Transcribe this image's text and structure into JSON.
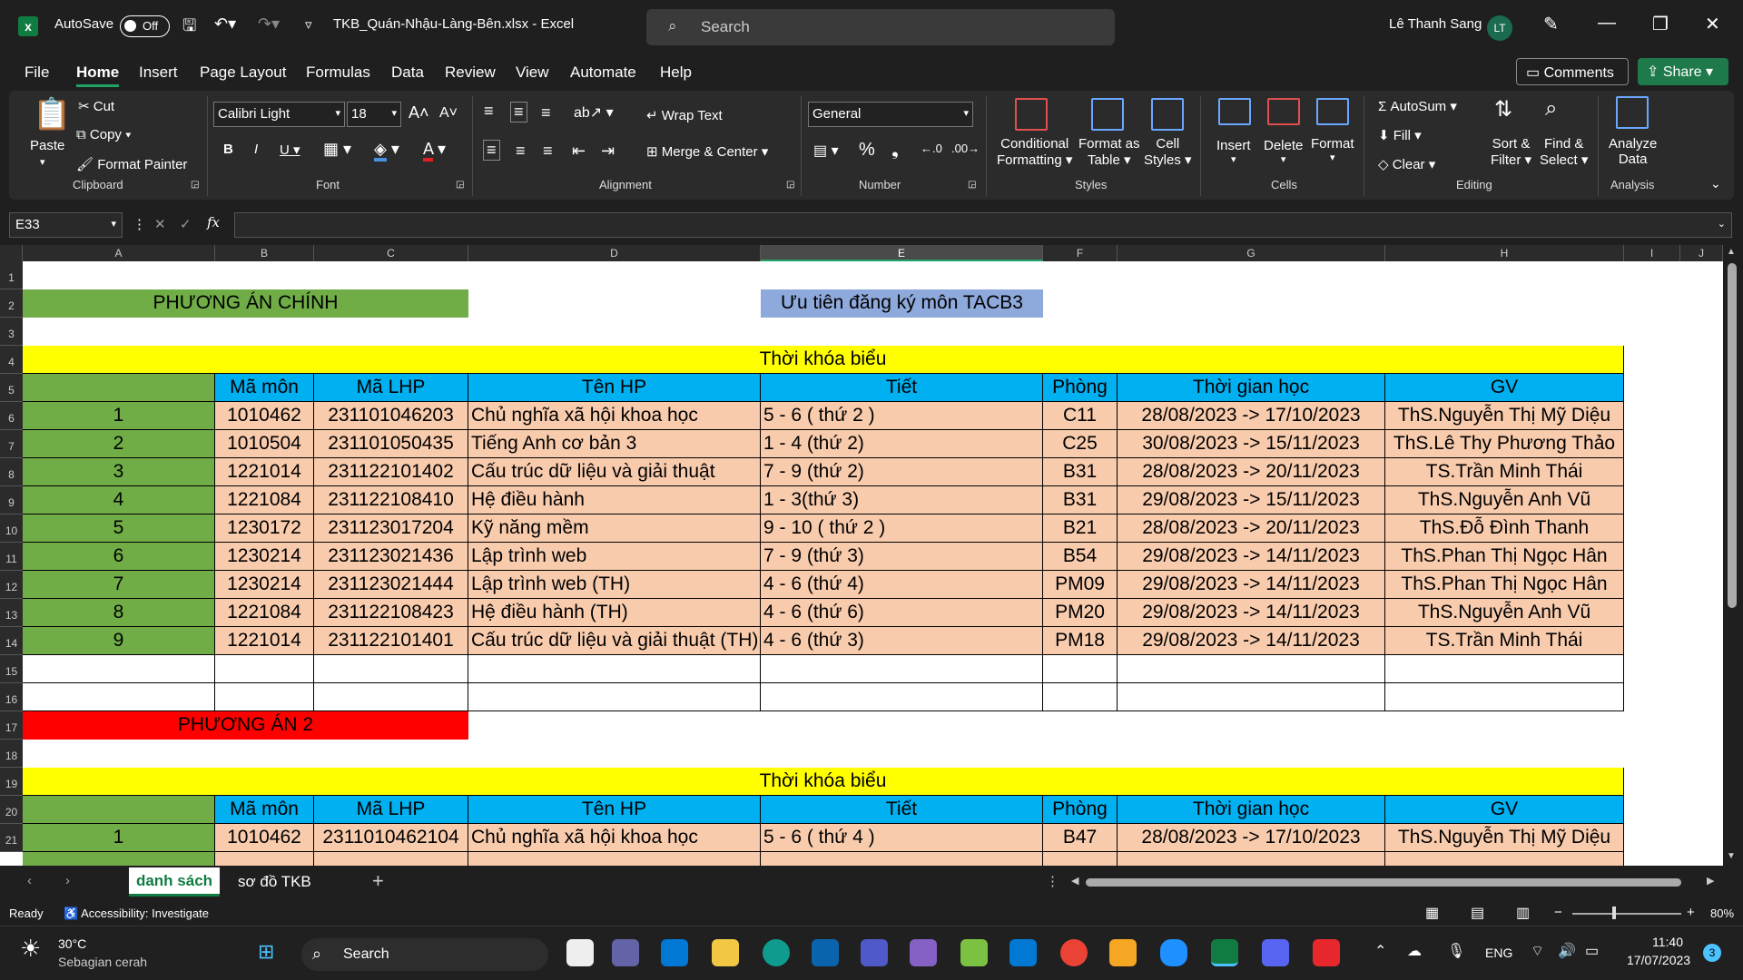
{
  "titlebar": {
    "autosave": "AutoSave",
    "toggle": "Off",
    "filename": "TKB_Quán-Nhậu-Làng-Bên.xlsx  -  Excel",
    "search": "Search",
    "user": "Lê Thanh Sang",
    "initials": "LT"
  },
  "menu": [
    "File",
    "Home",
    "Insert",
    "Page Layout",
    "Formulas",
    "Data",
    "Review",
    "View",
    "Automate",
    "Help"
  ],
  "comments": "Comments",
  "share": "Share",
  "ribbon": {
    "clipboard": {
      "paste": "Paste",
      "cut": "Cut",
      "copy": "Copy",
      "format_painter": "Format Painter",
      "group": "Clipboard"
    },
    "font": {
      "name": "Calibri Light",
      "size": "18",
      "group": "Font"
    },
    "alignment": {
      "wrap": "Wrap Text",
      "merge": "Merge & Center",
      "group": "Alignment"
    },
    "number": {
      "format": "General",
      "group": "Number"
    },
    "styles": {
      "cond1": "Conditional",
      "cond2": "Formatting",
      "fmt1": "Format as",
      "fmt2": "Table",
      "cell1": "Cell",
      "cell2": "Styles",
      "group": "Styles"
    },
    "cells": {
      "insert": "Insert",
      "delete": "Delete",
      "format": "Format",
      "group": "Cells"
    },
    "editing": {
      "autosum": "AutoSum",
      "fill": "Fill",
      "clear": "Clear",
      "sort1": "Sort &",
      "sort2": "Filter",
      "find1": "Find &",
      "find2": "Select",
      "group": "Editing"
    },
    "analysis": {
      "an1": "Analyze",
      "an2": "Data",
      "group": "Analysis"
    }
  },
  "formula": {
    "namebox": "E33",
    "fx": "fx",
    "content": ""
  },
  "columns": [
    "A",
    "B",
    "C",
    "D",
    "E",
    "F",
    "G",
    "H",
    "I",
    "J"
  ],
  "rows": [
    "1",
    "2",
    "3",
    "4",
    "5",
    "6",
    "7",
    "8",
    "9",
    "10",
    "11",
    "12",
    "13",
    "14",
    "15",
    "16",
    "17",
    "18",
    "19",
    "20",
    "21"
  ],
  "sheet": {
    "plan_main": "PHƯƠNG ÁN CHÍNH",
    "priority": "Ưu tiên đăng ký môn TACB3",
    "tkb_title": "Thời khóa biểu",
    "headers": [
      "Mã môn",
      "Mã LHP",
      "Tên HP",
      "Tiết",
      "Phòng",
      "Thời gian học",
      "GV"
    ],
    "table1": [
      [
        "1",
        "1010462",
        "231101046203",
        "Chủ nghĩa xã hội khoa học",
        "5 - 6 ( thứ 2 )",
        "C11",
        "28/08/2023 -> 17/10/2023",
        "ThS.Nguyễn Thị Mỹ Diệu"
      ],
      [
        "2",
        "1010504",
        "231101050435",
        "Tiếng Anh cơ bản 3",
        "1 - 4 (thứ 2)",
        "C25",
        "30/08/2023 -> 15/11/2023",
        "ThS.Lê Thy Phương Thảo"
      ],
      [
        "3",
        "1221014",
        "231122101402",
        "Cấu trúc dữ liệu và giải thuật",
        "7 - 9 (thứ 2)",
        "B31",
        "28/08/2023 -> 20/11/2023",
        "TS.Trần Minh Thái"
      ],
      [
        "4",
        "1221084",
        "231122108410",
        "Hệ điều hành",
        " 1 - 3(thứ 3)",
        "B31",
        "29/08/2023 -> 15/11/2023",
        "ThS.Nguyễn Anh Vũ"
      ],
      [
        "5",
        "1230172",
        "231123017204",
        "Kỹ năng mềm",
        "9 - 10 ( thứ 2 )",
        "B21",
        "28/08/2023 -> 20/11/2023",
        "ThS.Đỗ Đình Thanh"
      ],
      [
        "6",
        "1230214",
        "231123021436",
        "Lập trình web",
        "7 - 9 (thứ 3)",
        "B54",
        "29/08/2023 -> 14/11/2023",
        "ThS.Phan Thị Ngọc Hân"
      ],
      [
        "7",
        "1230214",
        "231123021444",
        "Lập trình web (TH)",
        "4 - 6 (thứ 4)",
        "PM09",
        "29/08/2023 -> 14/11/2023",
        "ThS.Phan Thị Ngọc Hân"
      ],
      [
        "8",
        "1221084",
        "231122108423",
        "Hệ điều hành (TH)",
        "4 - 6 (thứ 6)",
        "PM20",
        "29/08/2023 -> 14/11/2023",
        "ThS.Nguyễn Anh Vũ"
      ],
      [
        "9",
        "1221014",
        "231122101401",
        "Cấu trúc dữ liệu và giải thuật (TH)",
        "4 - 6 (thứ 3)",
        "PM18",
        "29/08/2023 -> 14/11/2023",
        "TS.Trần Minh Thái"
      ]
    ],
    "plan2": "PHƯƠNG ÁN 2",
    "table2": [
      [
        "1",
        "1010462",
        "2311010462104",
        "Chủ nghĩa xã hội khoa học",
        "5 - 6 ( thứ 4 )",
        "B47",
        "28/08/2023 -> 17/10/2023",
        "ThS.Nguyễn Thị Mỹ Diệu"
      ]
    ]
  },
  "tabs": [
    "danh sách",
    "sơ đồ TKB"
  ],
  "status": {
    "ready": "Ready",
    "accessibility": "Accessibility: Investigate",
    "zoom": "80%"
  },
  "taskbar": {
    "temp": "30°C",
    "weather": "Sebagian cerah",
    "search": "Search",
    "lang": "ENG",
    "time": "11:40",
    "date": "17/07/2023",
    "notif": "3"
  }
}
